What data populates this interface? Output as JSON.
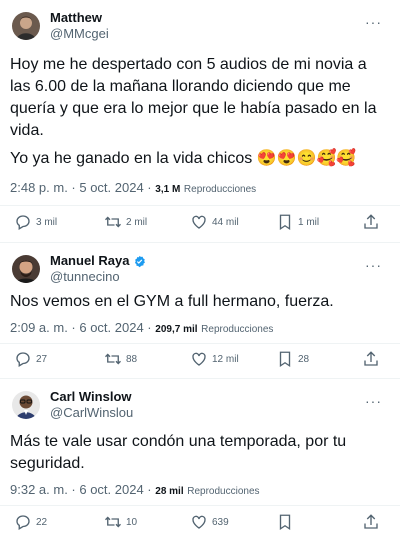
{
  "tweets": [
    {
      "name": "Matthew",
      "handle": "@MMcgei",
      "text_lines": [
        "Hoy me he despertado con 5 audios de mi novia a",
        "las 6.00 de la mañana llorando diciendo que me",
        "quería y que era lo mejor que le había pasado en la",
        "vida."
      ],
      "text_line2": "Yo ya he ganado en la vida chicos",
      "emojis": "😍😍😊🥰🥰",
      "time": "2:48 p. m. · 5 oct. 2024 ·",
      "views": "3,1 M",
      "views_label": "Reproducciones",
      "replies": "3 mil",
      "retweets": "2 mil",
      "likes": "44 mil",
      "bookmarks": "1 mil"
    },
    {
      "name": "Manuel Raya",
      "verified": true,
      "handle": "@tunnecino",
      "text": "Nos vemos en el GYM a full hermano, fuerza.",
      "time": "2:09 a. m. · 6 oct. 2024 ·",
      "views": "209,7 mil",
      "views_label": "Reproducciones",
      "replies": "27",
      "retweets": "88",
      "likes": "12 mil",
      "bookmarks": "28"
    },
    {
      "name": "Carl Winslow",
      "handle": "@CarlWinslou",
      "text_lines": [
        "Más te vale usar condón una temporada, por tu",
        "seguridad."
      ],
      "time": "9:32 a. m. · 6 oct. 2024 ·",
      "views": "28 mil",
      "views_label": "Reproducciones",
      "replies": "22",
      "retweets": "10",
      "likes": "639"
    }
  ],
  "more_glyph": "···",
  "colors": {
    "text": "#0f1419",
    "muted": "#536471",
    "verified": "#1d9bf0"
  }
}
